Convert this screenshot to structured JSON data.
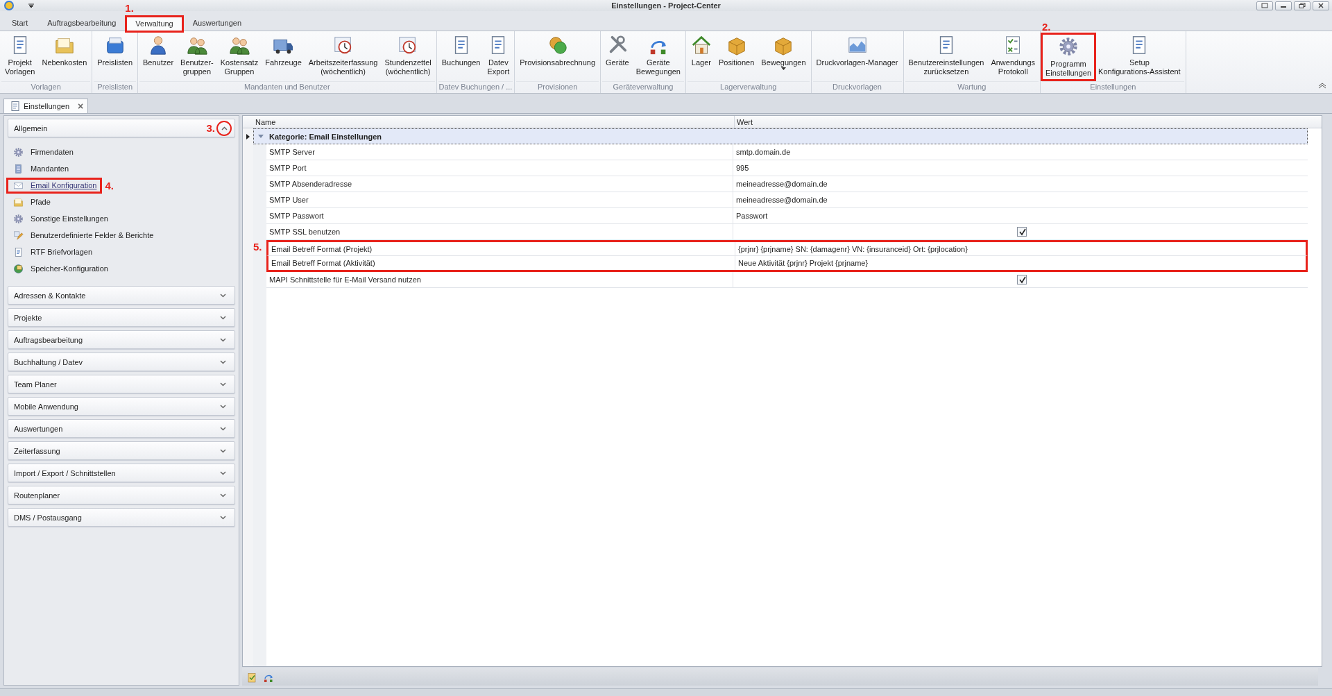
{
  "window": {
    "title": "Einstellungen - Project-Center"
  },
  "ribbon_tabs": [
    {
      "label": "Start",
      "selected": false
    },
    {
      "label": "Auftragsbearbeitung",
      "selected": false
    },
    {
      "label": "Verwaltung",
      "selected": true,
      "callout": "1."
    },
    {
      "label": "Auswertungen",
      "selected": false
    }
  ],
  "ribbon_groups": [
    {
      "label": "Vorlagen",
      "buttons": [
        {
          "lines": [
            "Projekt",
            "Vorlagen"
          ]
        },
        {
          "lines": [
            "Nebenkosten"
          ]
        }
      ]
    },
    {
      "label": "Preislisten",
      "buttons": [
        {
          "lines": [
            "Preislisten"
          ]
        }
      ]
    },
    {
      "label": "Mandanten und Benutzer",
      "buttons": [
        {
          "lines": [
            "Benutzer"
          ]
        },
        {
          "lines": [
            "Benutzer-",
            "gruppen"
          ]
        },
        {
          "lines": [
            "Kostensatz",
            "Gruppen"
          ]
        },
        {
          "lines": [
            "Fahrzeuge"
          ]
        },
        {
          "lines": [
            "Arbeitszeiterfassung",
            "(wöchentlich)"
          ]
        },
        {
          "lines": [
            "Stundenzettel",
            "(wöchentlich)"
          ]
        }
      ]
    },
    {
      "label": "Datev Buchungen / ...",
      "buttons": [
        {
          "lines": [
            "Buchungen"
          ]
        },
        {
          "lines": [
            "Datev",
            "Export"
          ]
        }
      ]
    },
    {
      "label": "Provisionen",
      "buttons": [
        {
          "lines": [
            "Provisionsabrechnung"
          ]
        }
      ]
    },
    {
      "label": "Geräteverwaltung",
      "buttons": [
        {
          "lines": [
            "Geräte"
          ]
        },
        {
          "lines": [
            "Geräte",
            "Bewegungen"
          ]
        }
      ]
    },
    {
      "label": "Lagerverwaltung",
      "buttons": [
        {
          "lines": [
            "Lager"
          ]
        },
        {
          "lines": [
            "Positionen"
          ]
        },
        {
          "lines": [
            "Bewegungen"
          ],
          "dropdown": true
        }
      ]
    },
    {
      "label": "Druckvorlagen",
      "buttons": [
        {
          "lines": [
            "Druckvorlagen-Manager"
          ]
        }
      ]
    },
    {
      "label": "Wartung",
      "buttons": [
        {
          "lines": [
            "Benutzereinstellungen",
            "zurücksetzen"
          ]
        },
        {
          "lines": [
            "Anwendungs",
            "Protokoll"
          ]
        }
      ]
    },
    {
      "label": "Einstellungen",
      "buttons": [
        {
          "lines": [
            "Programm",
            "Einstellungen"
          ],
          "callout": "2."
        },
        {
          "lines": [
            "Setup",
            "Konfigurations-Assistent"
          ]
        }
      ]
    }
  ],
  "document_tab": {
    "label": "Einstellungen",
    "close": "×"
  },
  "sidebar": {
    "sections": [
      {
        "label": "Allgemein",
        "expanded": true,
        "callout": "3.",
        "items": [
          {
            "label": "Firmendaten",
            "selected": false
          },
          {
            "label": "Mandanten",
            "selected": false
          },
          {
            "label": "Email Konfiguration",
            "selected": true,
            "callout": "4."
          },
          {
            "label": "Pfade",
            "selected": false
          },
          {
            "label": "Sonstige Einstellungen",
            "selected": false
          },
          {
            "label": "Benutzerdefinierte Felder & Berichte",
            "selected": false
          },
          {
            "label": "RTF Briefvorlagen",
            "selected": false
          },
          {
            "label": "Speicher-Konfiguration",
            "selected": false
          }
        ]
      },
      {
        "label": "Adressen & Kontakte",
        "expanded": false
      },
      {
        "label": "Projekte",
        "expanded": false
      },
      {
        "label": "Auftragsbearbeitung",
        "expanded": false
      },
      {
        "label": "Buchhaltung / Datev",
        "expanded": false
      },
      {
        "label": "Team Planer",
        "expanded": false
      },
      {
        "label": "Mobile Anwendung",
        "expanded": false
      },
      {
        "label": "Auswertungen",
        "expanded": false
      },
      {
        "label": "Zeiterfassung",
        "expanded": false
      },
      {
        "label": "Import / Export / Schnittstellen",
        "expanded": false
      },
      {
        "label": "Routenplaner",
        "expanded": false
      },
      {
        "label": "DMS / Postausgang",
        "expanded": false
      }
    ]
  },
  "grid": {
    "columns": [
      "Name",
      "Wert"
    ],
    "category": {
      "label": "Kategorie: Email Einstellungen",
      "expanded": true,
      "current": true
    },
    "callout_label": "5.",
    "rows": [
      {
        "name": "SMTP Server",
        "kind": "text",
        "value": "smtp.domain.de",
        "highlighted": false
      },
      {
        "name": "SMTP Port",
        "kind": "text",
        "value": "995",
        "highlighted": false
      },
      {
        "name": "SMTP Absenderadresse",
        "kind": "text",
        "value": "meineadresse@domain.de",
        "highlighted": false
      },
      {
        "name": "SMTP User",
        "kind": "text",
        "value": "meineadresse@domain.de",
        "highlighted": false
      },
      {
        "name": "SMTP Passwort",
        "kind": "text",
        "value": "Passwort",
        "highlighted": false
      },
      {
        "name": "SMTP SSL benutzen",
        "kind": "checkbox",
        "checked": true,
        "highlighted": false
      },
      {
        "name": "Email Betreff Format (Projekt)",
        "kind": "text",
        "value": "{prjnr} {prjname} SN: {damagenr} VN: {insuranceid} Ort: {prjlocation}",
        "highlighted": true
      },
      {
        "name": "Email Betreff Format (Aktivität)",
        "kind": "text",
        "value": "Neue Aktivität {prjnr} Projekt {prjname}",
        "highlighted": true
      },
      {
        "name": "MAPI Schnittstelle für E-Mail Versand nutzen",
        "kind": "checkbox",
        "checked": true,
        "highlighted": false
      }
    ]
  }
}
